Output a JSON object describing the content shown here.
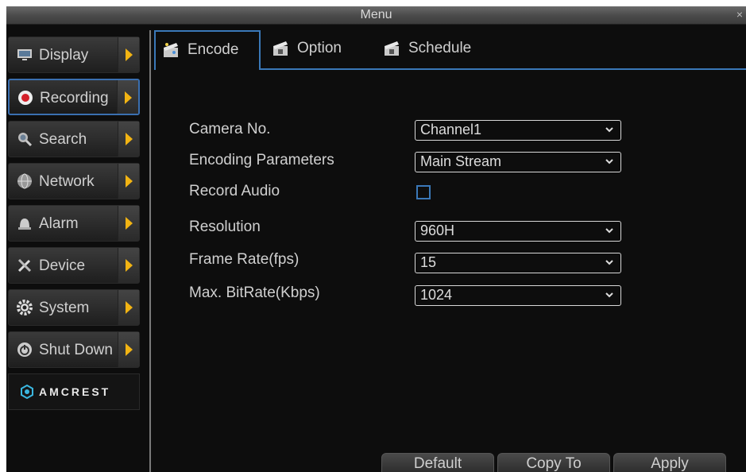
{
  "window": {
    "title": "Menu",
    "close": "×"
  },
  "sidebar": {
    "items": [
      {
        "label": "Display",
        "icon": "monitor-icon"
      },
      {
        "label": "Recording",
        "icon": "record-icon",
        "active": true
      },
      {
        "label": "Search",
        "icon": "magnifier-icon"
      },
      {
        "label": "Network",
        "icon": "network-globe-icon"
      },
      {
        "label": "Alarm",
        "icon": "alarm-bell-icon"
      },
      {
        "label": "Device",
        "icon": "tools-icon"
      },
      {
        "label": "System",
        "icon": "gear-icon"
      },
      {
        "label": "Shut Down",
        "icon": "power-icon"
      }
    ],
    "logo": "AMCREST"
  },
  "tabs": [
    {
      "label": "Encode",
      "active": true,
      "icon": "clapperboard-icon"
    },
    {
      "label": "Option",
      "icon": "clapperboard-icon"
    },
    {
      "label": "Schedule",
      "icon": "clapperboard-icon"
    }
  ],
  "form": {
    "camera_no": {
      "label": "Camera No.",
      "value": "Channel1"
    },
    "encoding_parameters": {
      "label": "Encoding Parameters",
      "value": "Main Stream"
    },
    "record_audio": {
      "label": "Record Audio",
      "checked": false
    },
    "resolution": {
      "label": "Resolution",
      "value": "960H"
    },
    "frame_rate": {
      "label": "Frame Rate(fps)",
      "value": "15"
    },
    "max_bitrate": {
      "label": "Max. BitRate(Kbps)",
      "value": "1024"
    }
  },
  "buttons": {
    "default": "Default",
    "copy_to": "Copy To",
    "apply": "Apply"
  },
  "colors": {
    "accent_blue": "#3a78b8",
    "arrow_yellow": "#f2b413",
    "background": "#0d0d0d"
  }
}
